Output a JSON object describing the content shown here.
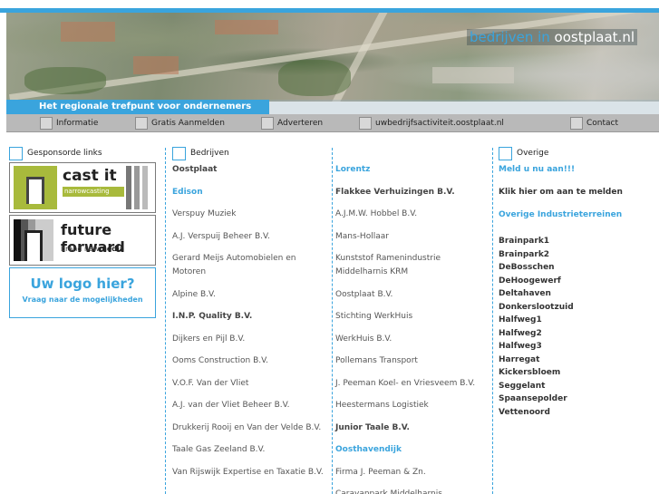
{
  "header": {
    "site_title_prefix": "bedrijven in",
    "site_title_suffix": "oostplaat.nl",
    "tagline": "Het regionale trefpunt voor ondernemers"
  },
  "nav": [
    {
      "label": "Informatie"
    },
    {
      "label": "Gratis Aanmelden"
    },
    {
      "label": "Adverteren"
    },
    {
      "label": "uwbedrijfsactiviteit.oostplaat.nl"
    },
    {
      "label": "Contact"
    }
  ],
  "sidebar": {
    "heading": "Gesponsorde links",
    "castit": {
      "title": "cast it",
      "sub": "narrowcasting"
    },
    "futureforward": {
      "title": "future forward",
      "sub_a": "brand new",
      "sub_b": "media"
    },
    "placeholder": {
      "title": "Uw logo hier?",
      "sub": "Vraag naar de mogelijkheden"
    }
  },
  "bedrijven": {
    "heading": "Bedrijven",
    "col1": [
      {
        "text": "Oostplaat",
        "style": "bold"
      },
      {
        "text": "Edison",
        "style": "blue"
      },
      {
        "text": "Verspuy Muziek",
        "style": ""
      },
      {
        "text": "A.J. Verspuij Beheer B.V.",
        "style": ""
      },
      {
        "text": "Gerard Meijs Automobielen en Motoren",
        "style": ""
      },
      {
        "text": "Alpine B.V.",
        "style": ""
      },
      {
        "text": "I.N.P. Quality B.V.",
        "style": "bold"
      },
      {
        "text": "Dijkers en Pijl B.V.",
        "style": ""
      },
      {
        "text": "Ooms Construction B.V.",
        "style": ""
      },
      {
        "text": "V.O.F. Van der Vliet",
        "style": ""
      },
      {
        "text": "A.J. van der Vliet Beheer B.V.",
        "style": ""
      },
      {
        "text": "Drukkerij Rooij en Van der Velde B.V.",
        "style": ""
      },
      {
        "text": "Taale Gas Zeeland B.V.",
        "style": ""
      },
      {
        "text": "Van Rijswijk Expertise en Taxatie B.V.",
        "style": ""
      }
    ],
    "col2": [
      {
        "text": "Lorentz",
        "style": "blue"
      },
      {
        "text": "Flakkee Verhuizingen B.V.",
        "style": "bold"
      },
      {
        "text": "A.J.M.W. Hobbel B.V.",
        "style": ""
      },
      {
        "text": "Mans-Hollaar",
        "style": ""
      },
      {
        "text": "Kunststof Ramenindustrie Middelharnis KRM",
        "style": ""
      },
      {
        "text": "Oostplaat B.V.",
        "style": ""
      },
      {
        "text": "Stichting WerkHuis",
        "style": ""
      },
      {
        "text": "WerkHuis B.V.",
        "style": ""
      },
      {
        "text": "Pollemans Transport",
        "style": ""
      },
      {
        "text": "J. Peeman Koel- en Vriesveem B.V.",
        "style": ""
      },
      {
        "text": "Heestermans Logistiek",
        "style": ""
      },
      {
        "text": "Junior Taale B.V.",
        "style": "bold"
      },
      {
        "text": "Oosthavendijk",
        "style": "blue"
      },
      {
        "text": "Firma J. Peeman & Zn.",
        "style": ""
      },
      {
        "text": "Caravanpark Middelharnis",
        "style": ""
      }
    ]
  },
  "overige": {
    "heading": "Overige",
    "meld": "Meld u nu aan!!!",
    "klik": "Klik hier om aan te melden",
    "industrie_heading": "Overige Industrieterreinen",
    "terreinen": [
      "Brainpark1",
      "Brainpark2",
      "DeBosschen",
      "DeHoogewerf",
      "Deltahaven",
      "Donkerslootzuid",
      "Halfweg1",
      "Halfweg2",
      "Halfweg3",
      "Harregat",
      "Kickersbloem",
      "Seggelant",
      "Spaansepolder",
      "Vettenoord"
    ]
  }
}
